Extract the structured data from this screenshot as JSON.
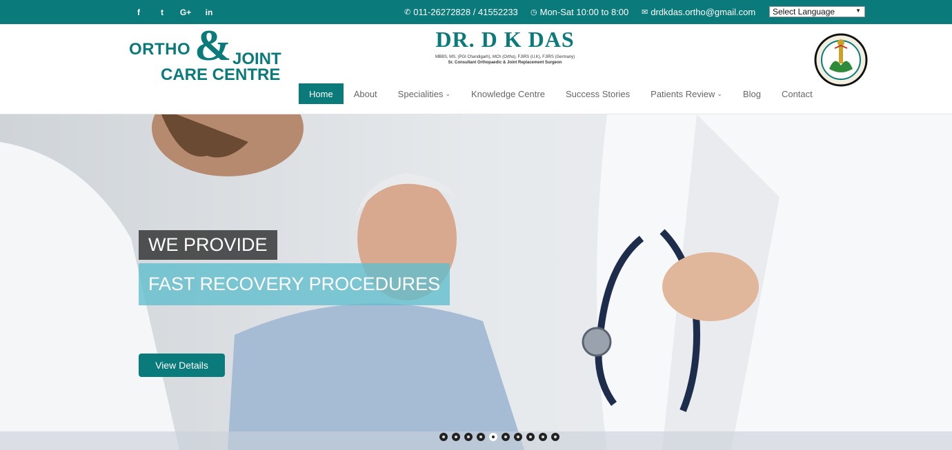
{
  "topbar": {
    "social": [
      {
        "label": "f",
        "icon": "facebook-icon"
      },
      {
        "label": "t",
        "icon": "twitter-icon"
      },
      {
        "label": "G+",
        "icon": "google-plus-icon"
      },
      {
        "label": "in",
        "icon": "linkedin-icon"
      }
    ],
    "phone": "011-26272828 / 41552233",
    "hours": "Mon-Sat 10:00 to 8:00",
    "email": "drdkdas.ortho@gmail.com",
    "language_select": "Select Language"
  },
  "logo": {
    "line1": "ORTHO",
    "amp": "&",
    "line2": "JOINT",
    "line3": "CARE CENTRE"
  },
  "brand": {
    "name": "DR. D K DAS",
    "qualifications": "MBBS, MS, (PGI Chandigarh), MCh (Ortho), FJIRS (U.K), FJIRS (Germany)",
    "title": "Sr. Consultant Orthopaedic & Joint Replacement Surgeon"
  },
  "emblem": {
    "ring_text": "BONE JOINT FRACTURE CARE CENTRE",
    "bottom_text": "NEW DELHI"
  },
  "nav": [
    {
      "label": "Home",
      "active": true,
      "dropdown": false
    },
    {
      "label": "About",
      "active": false,
      "dropdown": false
    },
    {
      "label": "Specialities",
      "active": false,
      "dropdown": true
    },
    {
      "label": "Knowledge Centre",
      "active": false,
      "dropdown": false
    },
    {
      "label": "Success Stories",
      "active": false,
      "dropdown": false
    },
    {
      "label": "Patients Review",
      "active": false,
      "dropdown": true
    },
    {
      "label": "Blog",
      "active": false,
      "dropdown": false
    },
    {
      "label": "Contact",
      "active": false,
      "dropdown": false
    }
  ],
  "hero": {
    "caption_top": "WE PROVIDE",
    "caption_main": "FAST RECOVERY PROCEDURES",
    "button": "View Details",
    "slides": 10,
    "active_slide": 5
  },
  "colors": {
    "brand": "#0b7a7b",
    "caption_dark": "#282828",
    "caption_light": "#5fbecd"
  }
}
